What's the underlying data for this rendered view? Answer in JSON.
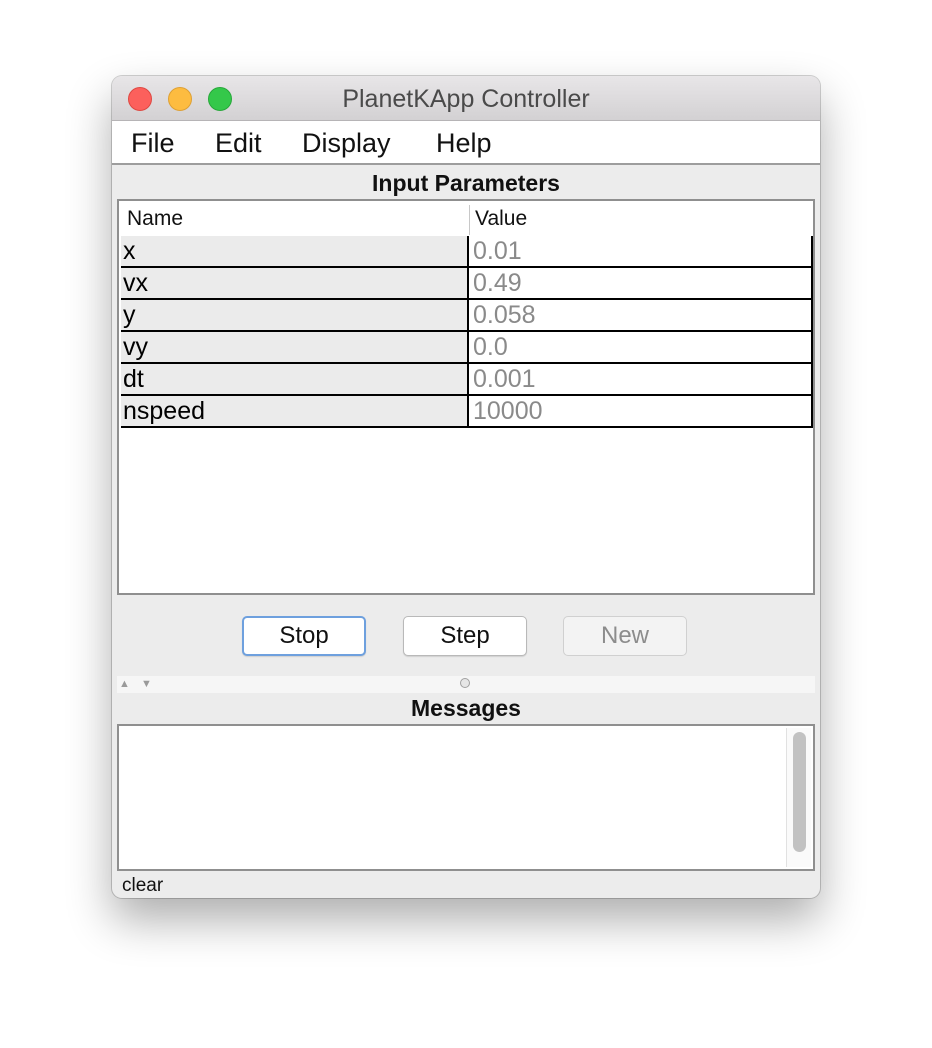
{
  "window": {
    "title": "PlanetKApp Controller"
  },
  "menu": {
    "items": [
      "File",
      "Edit",
      "Display",
      "Help"
    ]
  },
  "input_parameters": {
    "title": "Input Parameters",
    "columns": [
      "Name",
      "Value"
    ],
    "rows": [
      {
        "name": "x",
        "value": "0.01"
      },
      {
        "name": "vx",
        "value": "0.49"
      },
      {
        "name": "y",
        "value": "0.058"
      },
      {
        "name": "vy",
        "value": "0.0"
      },
      {
        "name": "dt",
        "value": "0.001"
      },
      {
        "name": "nspeed",
        "value": "10000"
      }
    ]
  },
  "buttons": {
    "stop": "Stop",
    "step": "Step",
    "new": "New"
  },
  "messages": {
    "title": "Messages",
    "content": "",
    "clear_label": "clear"
  },
  "colors": {
    "close": "#fc605c",
    "minimize": "#fdbc40",
    "zoom": "#34c84a",
    "focus_ring": "#6ea0de"
  }
}
